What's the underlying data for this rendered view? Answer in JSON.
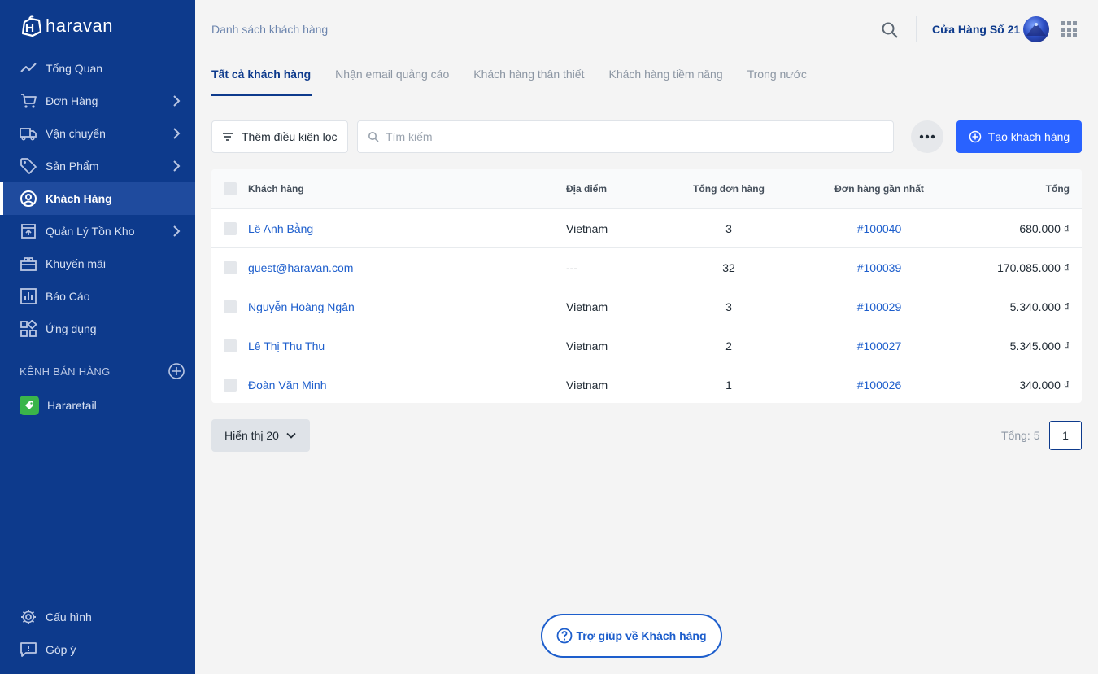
{
  "brand": {
    "name": "haravan"
  },
  "sidebar": {
    "items": [
      {
        "label": "Tổng Quan",
        "icon": "chart-line-icon",
        "has_arrow": false
      },
      {
        "label": "Đơn Hàng",
        "icon": "cart-icon",
        "has_arrow": true
      },
      {
        "label": "Vận chuyển",
        "icon": "truck-icon",
        "has_arrow": true
      },
      {
        "label": "Sản Phẩm",
        "icon": "tag-icon",
        "has_arrow": true
      },
      {
        "label": "Khách Hàng",
        "icon": "user-circle-icon",
        "has_arrow": false,
        "active": true
      },
      {
        "label": "Quản Lý Tồn Kho",
        "icon": "inventory-box-icon",
        "has_arrow": true
      },
      {
        "label": "Khuyến mãi",
        "icon": "promotion-icon",
        "has_arrow": false
      },
      {
        "label": "Báo Cáo",
        "icon": "report-icon",
        "has_arrow": false
      },
      {
        "label": "Ứng dụng",
        "icon": "apps-grid-icon",
        "has_arrow": false
      }
    ],
    "channels_heading": "KÊNH BÁN HÀNG",
    "channels": [
      {
        "label": "Hararetail",
        "icon": "hararetail-icon"
      }
    ],
    "bottom_items": [
      {
        "label": "Cấu hình",
        "icon": "gear-icon"
      },
      {
        "label": "Góp ý",
        "icon": "feedback-icon"
      }
    ]
  },
  "header": {
    "breadcrumb": "Danh sách khách hàng",
    "store_name": "Cửa Hàng Số 21"
  },
  "tabs": [
    {
      "label": "Tất cả khách hàng",
      "active": true
    },
    {
      "label": "Nhận email quảng cáo"
    },
    {
      "label": "Khách hàng thân thiết"
    },
    {
      "label": "Khách hàng tiềm năng"
    },
    {
      "label": "Trong nước"
    }
  ],
  "toolbar": {
    "filter_label": "Thêm điều kiện lọc",
    "search_placeholder": "Tìm kiếm",
    "create_label": "Tạo khách hàng"
  },
  "table": {
    "columns": [
      "Khách hàng",
      "Địa điểm",
      "Tổng đơn hàng",
      "Đơn hàng gần nhất",
      "Tổng"
    ],
    "rows": [
      {
        "name": "Lê Anh Bằng",
        "location": "Vietnam",
        "orders": "3",
        "last_order": "#100040",
        "total": "680.000 ₫"
      },
      {
        "name": "guest@haravan.com",
        "location": "---",
        "orders": "32",
        "last_order": "#100039",
        "total": "170.085.000 ₫"
      },
      {
        "name": "Nguyễn Hoàng Ngân",
        "location": "Vietnam",
        "orders": "3",
        "last_order": "#100029",
        "total": "5.340.000 ₫"
      },
      {
        "name": "Lê Thị Thu Thu",
        "location": "Vietnam",
        "orders": "2",
        "last_order": "#100027",
        "total": "5.345.000 ₫"
      },
      {
        "name": "Đoàn Văn Minh",
        "location": "Vietnam",
        "orders": "1",
        "last_order": "#100026",
        "total": "340.000 ₫"
      }
    ]
  },
  "pagination": {
    "page_size_label": "Hiển thị 20",
    "total_label": "Tổng: 5",
    "current_page": "1"
  },
  "help": {
    "label": "Trợ giúp về Khách hàng"
  },
  "colors": {
    "sidebar_bg": "#0d3a8c",
    "primary": "#2962ff",
    "link": "#1d5ecc"
  }
}
